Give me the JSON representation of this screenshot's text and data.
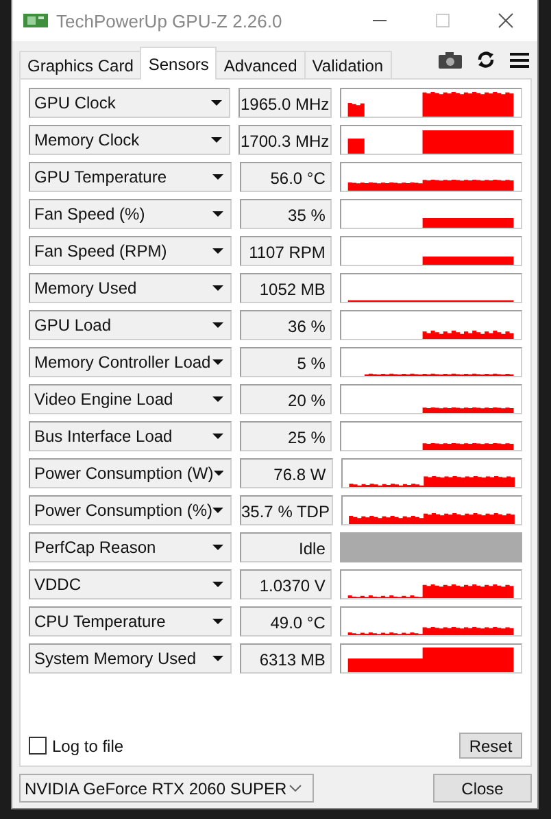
{
  "window": {
    "title": "TechPowerUp GPU-Z 2.26.0"
  },
  "tabs": [
    {
      "label": "Graphics Card",
      "selected": false
    },
    {
      "label": "Sensors",
      "selected": true
    },
    {
      "label": "Advanced",
      "selected": false
    },
    {
      "label": "Validation",
      "selected": false
    }
  ],
  "sensors": [
    {
      "name": "GPU Clock",
      "value": "1965.0 MHz",
      "kind": "plot"
    },
    {
      "name": "Memory Clock",
      "value": "1700.3 MHz",
      "kind": "plot"
    },
    {
      "name": "GPU Temperature",
      "value": "56.0 °C",
      "kind": "plot"
    },
    {
      "name": "Fan Speed (%)",
      "value": "35 %",
      "kind": "plot"
    },
    {
      "name": "Fan Speed (RPM)",
      "value": "1107 RPM",
      "kind": "plot"
    },
    {
      "name": "Memory Used",
      "value": "1052 MB",
      "kind": "plot"
    },
    {
      "name": "GPU Load",
      "value": "36 %",
      "kind": "plot"
    },
    {
      "name": "Memory Controller Load",
      "value": "5 %",
      "kind": "plot"
    },
    {
      "name": "Video Engine Load",
      "value": "20 %",
      "kind": "plot"
    },
    {
      "name": "Bus Interface Load",
      "value": "25 %",
      "kind": "plot"
    },
    {
      "name": "Power Consumption (W)",
      "value": "76.8 W",
      "kind": "plot"
    },
    {
      "name": "Power Consumption (%)",
      "value": "35.7 % TDP",
      "kind": "plot"
    },
    {
      "name": "PerfCap Reason",
      "value": "Idle",
      "kind": "flag"
    },
    {
      "name": "VDDC",
      "value": "1.0370 V",
      "kind": "plot"
    },
    {
      "name": "CPU Temperature",
      "value": "49.0 °C",
      "kind": "plot"
    },
    {
      "name": "System Memory Used",
      "value": "6313 MB",
      "kind": "plot"
    }
  ],
  "log_to_file": {
    "label": "Log to file",
    "checked": false
  },
  "reset_button": "Reset",
  "gpu_select": {
    "value": "NVIDIA GeForce RTX 2060 SUPER"
  },
  "close_button": "Close"
}
